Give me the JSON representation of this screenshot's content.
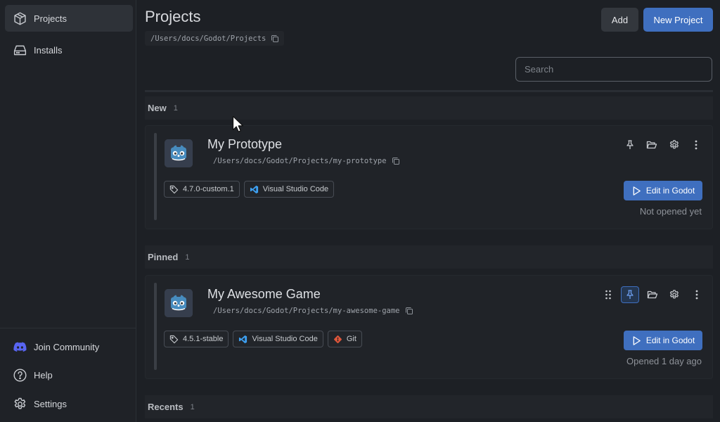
{
  "sidebar": {
    "items": [
      {
        "label": "Projects",
        "icon": "cube-icon",
        "active": true
      },
      {
        "label": "Installs",
        "icon": "drive-icon",
        "active": false
      }
    ],
    "bottom": [
      {
        "label": "Join Community",
        "icon": "discord-icon"
      },
      {
        "label": "Help",
        "icon": "help-icon"
      },
      {
        "label": "Settings",
        "icon": "gear-icon"
      }
    ]
  },
  "header": {
    "title": "Projects",
    "path": "/Users/docs/Godot/Projects",
    "add_label": "Add",
    "new_label": "New Project"
  },
  "search": {
    "placeholder": "Search",
    "value": ""
  },
  "sections": [
    {
      "label": "New",
      "count": "1"
    },
    {
      "label": "Pinned",
      "count": "1"
    },
    {
      "label": "Recents",
      "count": "1"
    }
  ],
  "projects": [
    {
      "name": "My Prototype",
      "path": "/Users/docs/Godot/Projects/my-prototype",
      "version": "4.7.0-custom.1",
      "editor": "Visual Studio Code",
      "edit_label": "Edit in Godot",
      "opened": "Not opened yet",
      "pinned": false
    },
    {
      "name": "My Awesome Game",
      "path": "/Users/docs/Godot/Projects/my-awesome-game",
      "version": "4.5.1-stable",
      "editor": "Visual Studio Code",
      "vcs": "Git",
      "edit_label": "Edit in Godot",
      "opened": "Opened 1 day ago",
      "pinned": true
    }
  ],
  "colors": {
    "accent": "#3f6fbf",
    "background": "#1d2025",
    "sidebar": "#1f2227",
    "git": "#e0573b",
    "vscode": "#3ea0f0",
    "discord": "#5865f2"
  }
}
